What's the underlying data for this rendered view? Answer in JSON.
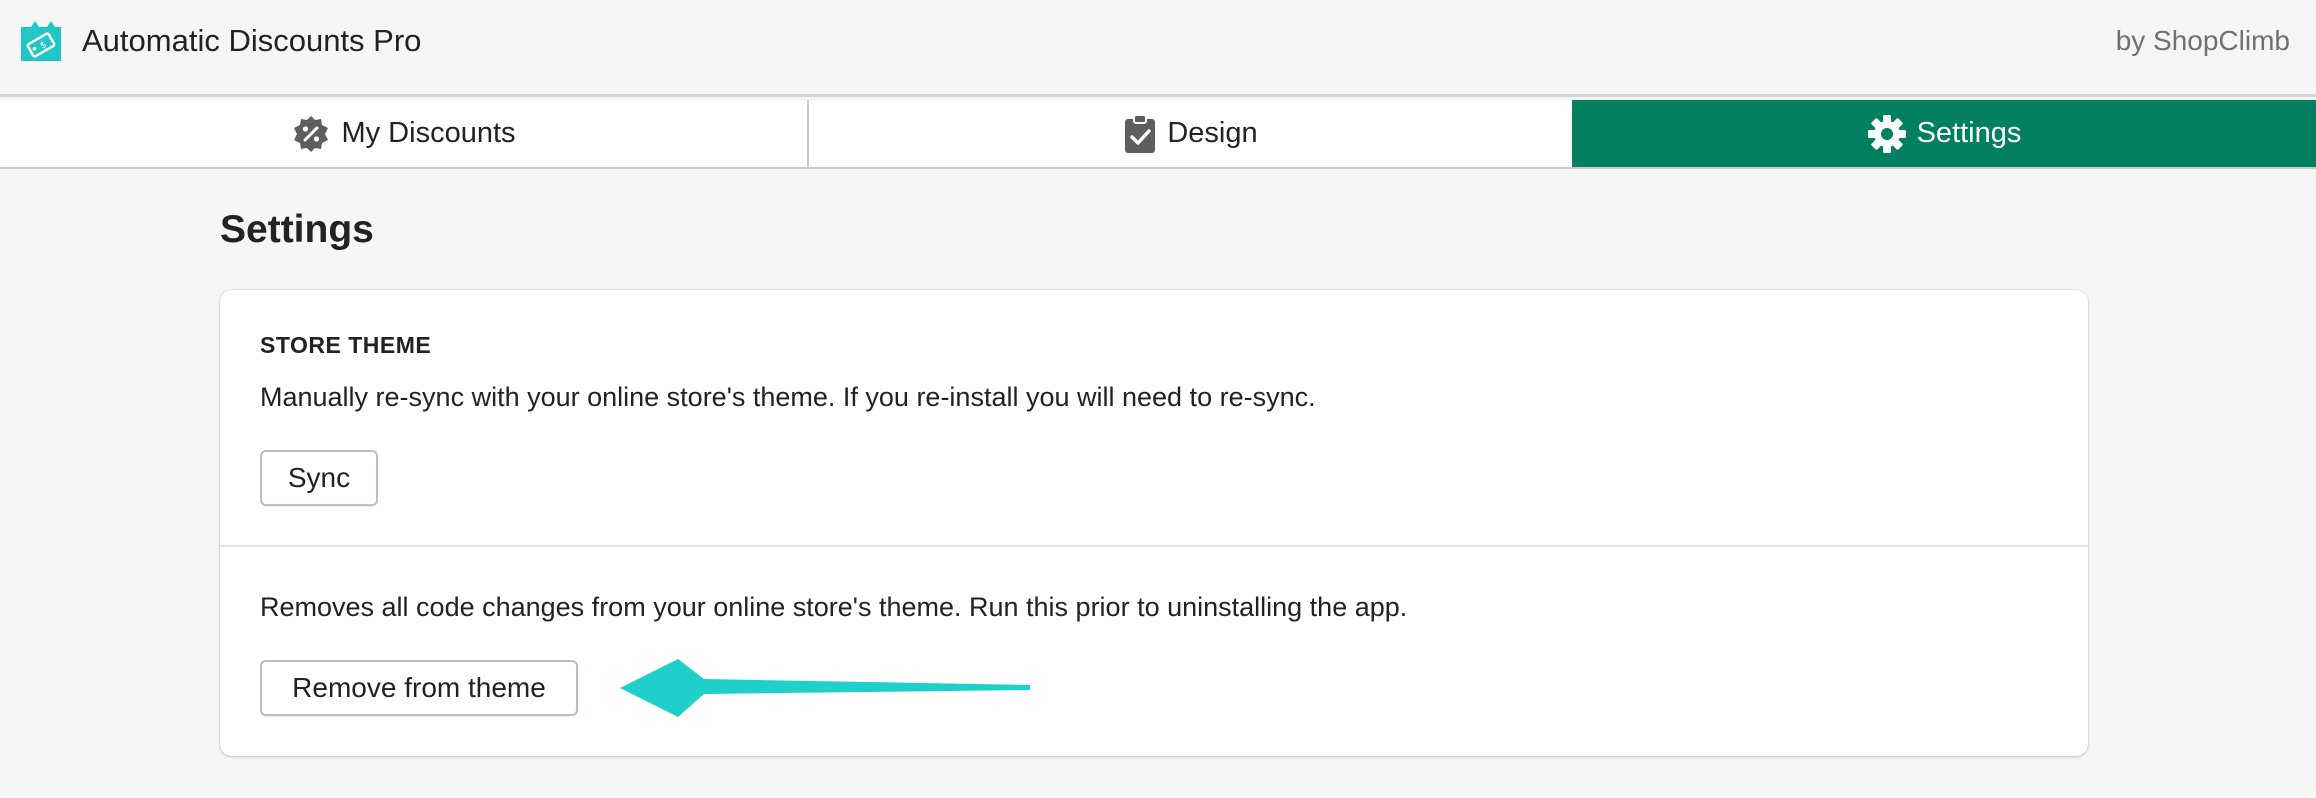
{
  "header": {
    "app_title": "Automatic Discounts Pro",
    "byline": "by ShopClimb",
    "logo_icon": "tag-icon"
  },
  "tabs": [
    {
      "label": "My Discounts",
      "icon": "discount-badge-icon",
      "active": false
    },
    {
      "label": "Design",
      "icon": "clipboard-check-icon",
      "active": false
    },
    {
      "label": "Settings",
      "icon": "gear-icon",
      "active": true
    }
  ],
  "page": {
    "title": "Settings"
  },
  "store_theme": {
    "heading": "STORE THEME",
    "sync_description": "Manually re-sync with your online store's theme. If you re-install you will need to re-sync.",
    "sync_button": "Sync",
    "remove_description": "Removes all code changes from your online store's theme. Run this prior to uninstalling the app.",
    "remove_button": "Remove from theme"
  },
  "colors": {
    "accent_green": "#008060",
    "logo_teal": "#21c7c4",
    "arrow_teal": "#1fcfc9"
  }
}
